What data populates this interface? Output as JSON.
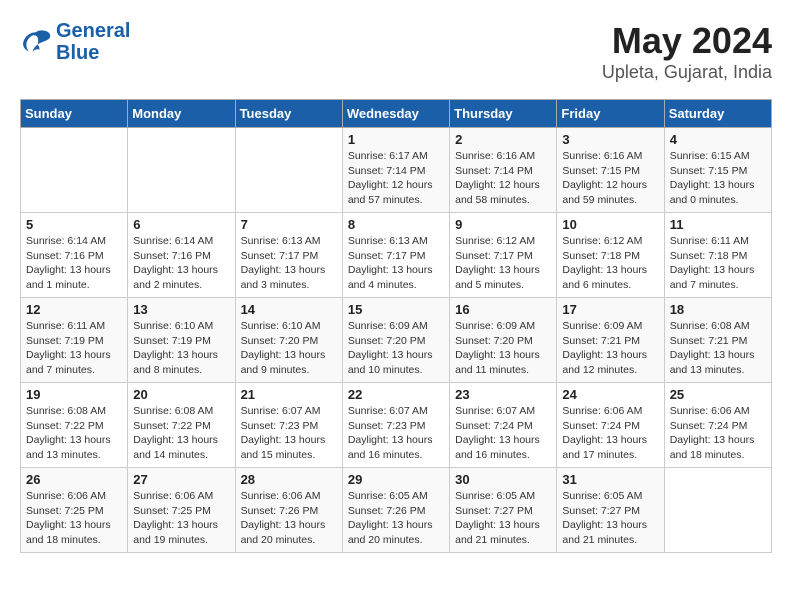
{
  "logo": {
    "line1": "General",
    "line2": "Blue"
  },
  "title": "May 2024",
  "subtitle": "Upleta, Gujarat, India",
  "days_header": [
    "Sunday",
    "Monday",
    "Tuesday",
    "Wednesday",
    "Thursday",
    "Friday",
    "Saturday"
  ],
  "weeks": [
    [
      {
        "day": "",
        "info": ""
      },
      {
        "day": "",
        "info": ""
      },
      {
        "day": "",
        "info": ""
      },
      {
        "day": "1",
        "info": "Sunrise: 6:17 AM\nSunset: 7:14 PM\nDaylight: 12 hours and 57 minutes."
      },
      {
        "day": "2",
        "info": "Sunrise: 6:16 AM\nSunset: 7:14 PM\nDaylight: 12 hours and 58 minutes."
      },
      {
        "day": "3",
        "info": "Sunrise: 6:16 AM\nSunset: 7:15 PM\nDaylight: 12 hours and 59 minutes."
      },
      {
        "day": "4",
        "info": "Sunrise: 6:15 AM\nSunset: 7:15 PM\nDaylight: 13 hours and 0 minutes."
      }
    ],
    [
      {
        "day": "5",
        "info": "Sunrise: 6:14 AM\nSunset: 7:16 PM\nDaylight: 13 hours and 1 minute."
      },
      {
        "day": "6",
        "info": "Sunrise: 6:14 AM\nSunset: 7:16 PM\nDaylight: 13 hours and 2 minutes."
      },
      {
        "day": "7",
        "info": "Sunrise: 6:13 AM\nSunset: 7:17 PM\nDaylight: 13 hours and 3 minutes."
      },
      {
        "day": "8",
        "info": "Sunrise: 6:13 AM\nSunset: 7:17 PM\nDaylight: 13 hours and 4 minutes."
      },
      {
        "day": "9",
        "info": "Sunrise: 6:12 AM\nSunset: 7:17 PM\nDaylight: 13 hours and 5 minutes."
      },
      {
        "day": "10",
        "info": "Sunrise: 6:12 AM\nSunset: 7:18 PM\nDaylight: 13 hours and 6 minutes."
      },
      {
        "day": "11",
        "info": "Sunrise: 6:11 AM\nSunset: 7:18 PM\nDaylight: 13 hours and 7 minutes."
      }
    ],
    [
      {
        "day": "12",
        "info": "Sunrise: 6:11 AM\nSunset: 7:19 PM\nDaylight: 13 hours and 7 minutes."
      },
      {
        "day": "13",
        "info": "Sunrise: 6:10 AM\nSunset: 7:19 PM\nDaylight: 13 hours and 8 minutes."
      },
      {
        "day": "14",
        "info": "Sunrise: 6:10 AM\nSunset: 7:20 PM\nDaylight: 13 hours and 9 minutes."
      },
      {
        "day": "15",
        "info": "Sunrise: 6:09 AM\nSunset: 7:20 PM\nDaylight: 13 hours and 10 minutes."
      },
      {
        "day": "16",
        "info": "Sunrise: 6:09 AM\nSunset: 7:20 PM\nDaylight: 13 hours and 11 minutes."
      },
      {
        "day": "17",
        "info": "Sunrise: 6:09 AM\nSunset: 7:21 PM\nDaylight: 13 hours and 12 minutes."
      },
      {
        "day": "18",
        "info": "Sunrise: 6:08 AM\nSunset: 7:21 PM\nDaylight: 13 hours and 13 minutes."
      }
    ],
    [
      {
        "day": "19",
        "info": "Sunrise: 6:08 AM\nSunset: 7:22 PM\nDaylight: 13 hours and 13 minutes."
      },
      {
        "day": "20",
        "info": "Sunrise: 6:08 AM\nSunset: 7:22 PM\nDaylight: 13 hours and 14 minutes."
      },
      {
        "day": "21",
        "info": "Sunrise: 6:07 AM\nSunset: 7:23 PM\nDaylight: 13 hours and 15 minutes."
      },
      {
        "day": "22",
        "info": "Sunrise: 6:07 AM\nSunset: 7:23 PM\nDaylight: 13 hours and 16 minutes."
      },
      {
        "day": "23",
        "info": "Sunrise: 6:07 AM\nSunset: 7:24 PM\nDaylight: 13 hours and 16 minutes."
      },
      {
        "day": "24",
        "info": "Sunrise: 6:06 AM\nSunset: 7:24 PM\nDaylight: 13 hours and 17 minutes."
      },
      {
        "day": "25",
        "info": "Sunrise: 6:06 AM\nSunset: 7:24 PM\nDaylight: 13 hours and 18 minutes."
      }
    ],
    [
      {
        "day": "26",
        "info": "Sunrise: 6:06 AM\nSunset: 7:25 PM\nDaylight: 13 hours and 18 minutes."
      },
      {
        "day": "27",
        "info": "Sunrise: 6:06 AM\nSunset: 7:25 PM\nDaylight: 13 hours and 19 minutes."
      },
      {
        "day": "28",
        "info": "Sunrise: 6:06 AM\nSunset: 7:26 PM\nDaylight: 13 hours and 20 minutes."
      },
      {
        "day": "29",
        "info": "Sunrise: 6:05 AM\nSunset: 7:26 PM\nDaylight: 13 hours and 20 minutes."
      },
      {
        "day": "30",
        "info": "Sunrise: 6:05 AM\nSunset: 7:27 PM\nDaylight: 13 hours and 21 minutes."
      },
      {
        "day": "31",
        "info": "Sunrise: 6:05 AM\nSunset: 7:27 PM\nDaylight: 13 hours and 21 minutes."
      },
      {
        "day": "",
        "info": ""
      }
    ]
  ]
}
